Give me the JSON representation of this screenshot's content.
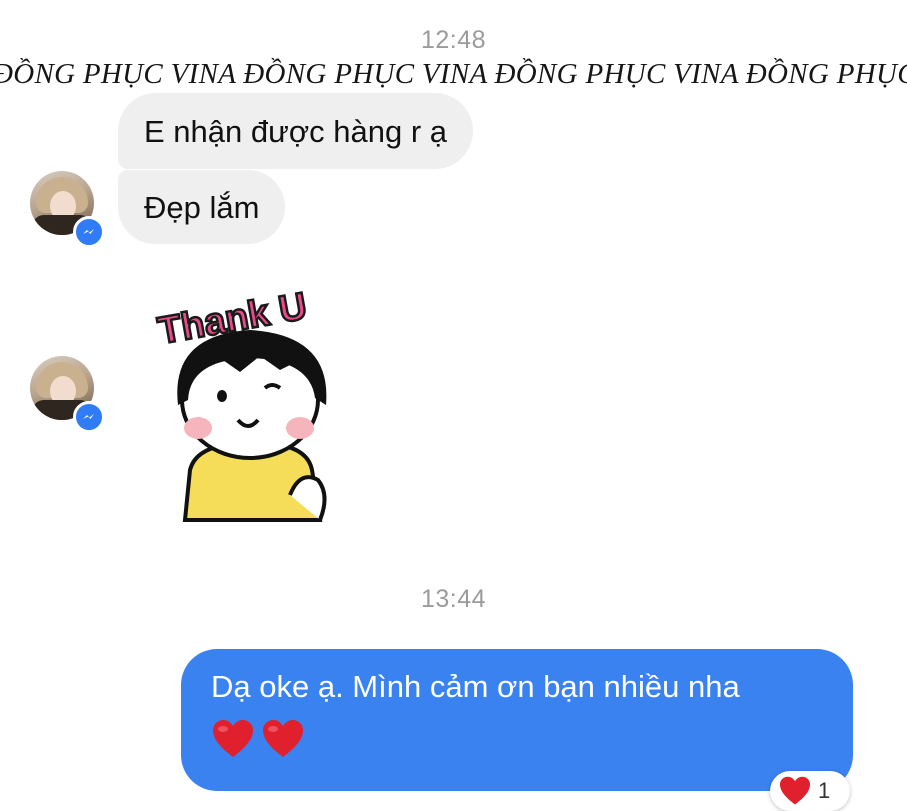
{
  "watermark": "ĐỒNG PHỤC VINA ĐỒNG PHỤC VINA ĐỒNG PHỤC VINA ĐỒNG PHỤC VINA",
  "conversation": {
    "timestamp_1": "12:48",
    "incoming": [
      {
        "text": "E nhận được hàng r ạ"
      },
      {
        "text": "Đẹp lắm"
      }
    ],
    "sticker": {
      "text": "Thank U",
      "icon": "thank-you-girl-sticker"
    },
    "timestamp_2": "13:44",
    "outgoing": {
      "text": "Dạ oke ạ. Mình cảm ơn bạn nhiều nha",
      "emoji": [
        "❤️",
        "❤️"
      ]
    },
    "reaction": {
      "emoji": "❤️",
      "count": "1"
    }
  },
  "colors": {
    "outgoing_bubble": "#3b82f1",
    "incoming_bubble": "#efefef",
    "messenger_badge": "#2f7cf6",
    "heart": "#e0202d"
  },
  "icons": {
    "avatar": "user-avatar",
    "badge": "messenger-icon",
    "heart": "heart-icon"
  }
}
